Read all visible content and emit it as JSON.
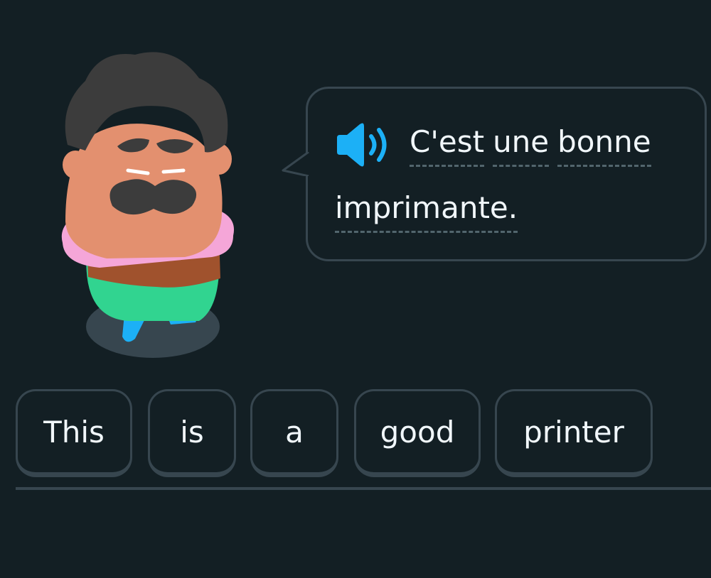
{
  "prompt": {
    "line1_words": [
      "C'est",
      "une",
      "bonne"
    ],
    "line2_words": [
      "imprimante."
    ]
  },
  "answer": {
    "chips": [
      "This",
      "is",
      "a",
      "good",
      "printer"
    ]
  },
  "icons": {
    "speaker": "speaker-icon",
    "character": "character-illustration"
  },
  "colors": {
    "background": "#131f24",
    "border": "#37464f",
    "text": "#f1f7fb",
    "accent": "#1cb0f6"
  }
}
